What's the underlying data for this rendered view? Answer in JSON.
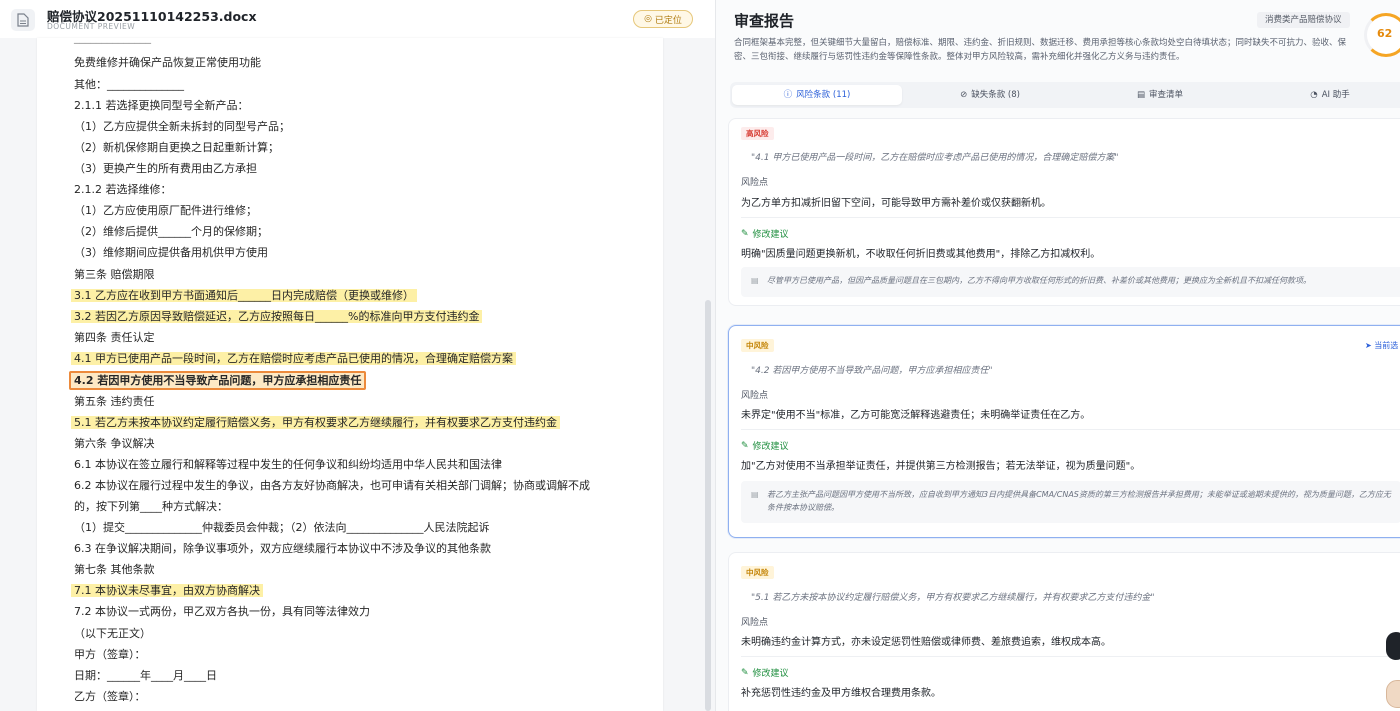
{
  "doc": {
    "file_name": "赔偿协议20251110142253.docx",
    "subtitle": "DOCUMENT PREVIEW",
    "locate_label": "已定位",
    "lines": [
      "免费维修并确保产品恢复正常使用功能",
      "其他：______________",
      "2.1.1 若选择更换同型号全新产品：",
      "（1）乙方应提供全新未拆封的同型号产品；",
      "（2）新机保修期自更换之日起重新计算；",
      "（3）更换产生的所有费用由乙方承担",
      "2.1.2 若选择维修：",
      "（1）乙方应使用原厂配件进行维修；",
      "（2）维修后提供______个月的保修期；",
      "（3）维修期间应提供备用机供甲方使用",
      "第三条 赔偿期限",
      "3.1 乙方应在收到甲方书面通知后______日内完成赔偿（更换或维修）",
      "3.2 若因乙方原因导致赔偿延迟，乙方应按照每日______%的标准向甲方支付违约金",
      "第四条 责任认定",
      "4.1 甲方已使用产品一段时间，乙方在赔偿时应考虑产品已使用的情况，合理确定赔偿方案",
      "4.2 若因甲方使用不当导致产品问题，甲方应承担相应责任",
      "第五条 违约责任",
      "5.1 若乙方未按本协议约定履行赔偿义务，甲方有权要求乙方继续履行，并有权要求乙方支付违约金",
      "第六条 争议解决",
      "6.1 本协议在签立履行和解释等过程中发生的任何争议和纠纷均适用中华人民共和国法律",
      "6.2 本协议在履行过程中发生的争议，由各方友好协商解决，也可申请有关相关部门调解；协商或调解不成",
      "的，按下列第____种方式解决：",
      "（1）提交______________仲裁委员会仲裁；（2）依法向______________人民法院起诉",
      "6.3 在争议解决期间，除争议事项外，双方应继续履行本协议中不涉及争议的其他条款",
      "第七条 其他条款",
      "7.1 本协议未尽事宜，由双方协商解决",
      "7.2 本协议一式两份，甲乙双方各执一份，具有同等法律效力",
      "（以下无正文）",
      "甲方（签章）：",
      "日期：______年____月____日",
      "乙方（签章）："
    ]
  },
  "report": {
    "title": "审查报告",
    "tag": "消费类产品赔偿协议",
    "score": "62",
    "summary": "合同框架基本完整，但关键细节大量留白，赔偿标准、期限、违约金、折旧规则、数据迁移、费用承担等核心条款均处空白待填状态；同时缺失不可抗力、验收、保密、三包衔接、继续履行与惩罚性违约金等保障性条款。整体对甲方风险较高，需补充细化并强化乙方义务与违约责任。",
    "tabs": [
      {
        "label": "风险条款 (11)",
        "icon": "ⓘ"
      },
      {
        "label": "缺失条款 (8)",
        "icon": "⊘"
      },
      {
        "label": "审查清单",
        "icon": "▤"
      },
      {
        "label": "AI 助手",
        "icon": "◔"
      }
    ],
    "risk_label": "风险点",
    "suggest_label": "修改建议",
    "locate_current": "当前选",
    "cards": [
      {
        "level": "高风险",
        "quote": "\"4.1 甲方已使用产品一段时间，乙方在赔偿时应考虑产品已使用的情况，合理确定赔偿方案\"",
        "risk": "为乙方单方扣减折旧留下空间，可能导致甲方需补差价或仅获翻新机。",
        "suggestion": "明确\"因质量问题更换新机，不收取任何折旧费或其他费用\"，排除乙方扣减权利。",
        "note": "尽管甲方已使用产品，但因产品质量问题且在三包期内，乙方不得向甲方收取任何形式的折旧费、补差价或其他费用；更换应为全新机且不扣减任何款项。"
      },
      {
        "level": "中风险",
        "quote": "\"4.2 若因甲方使用不当导致产品问题，甲方应承担相应责任\"",
        "risk": "未界定\"使用不当\"标准，乙方可能宽泛解释逃避责任；未明确举证责任在乙方。",
        "suggestion": "加\"乙方对使用不当承担举证责任，并提供第三方检测报告；若无法举证，视为质量问题\"。",
        "note": "若乙方主张产品问题因甲方使用不当所致，应自收到甲方通知3日内提供具备CMA/CNAS资质的第三方检测报告并承担费用；未能举证或逾期未提供的，视为质量问题，乙方应无条件按本协议赔偿。"
      },
      {
        "level": "中风险",
        "quote": "\"5.1 若乙方未按本协议约定履行赔偿义务，甲方有权要求乙方继续履行，并有权要求乙方支付违约金\"",
        "risk": "未明确违约金计算方式，亦未设定惩罚性赔偿或律师费、差旅费追索，维权成本高。",
        "suggestion": "补充惩罚性违约金及甲方维权合理费用条款。"
      }
    ]
  }
}
